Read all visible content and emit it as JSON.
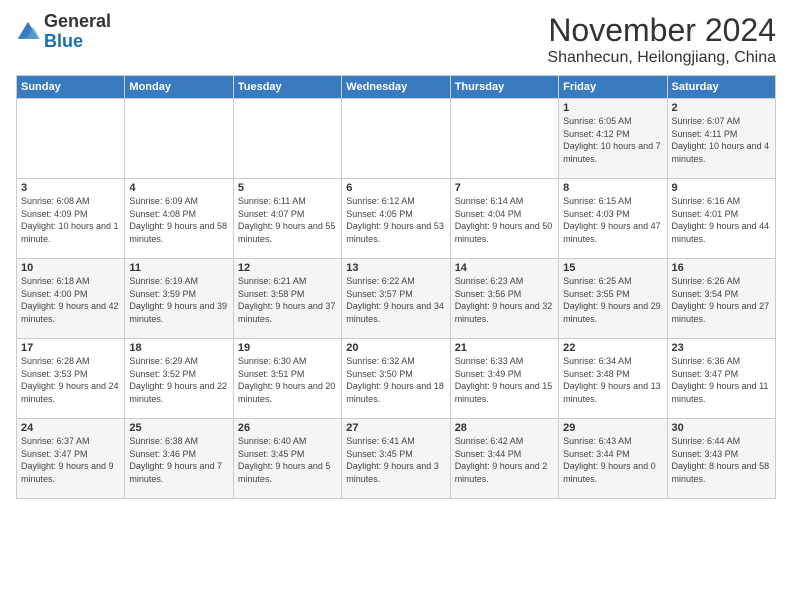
{
  "logo": {
    "general": "General",
    "blue": "Blue"
  },
  "title": {
    "month_year": "November 2024",
    "location": "Shanhecun, Heilongjiang, China"
  },
  "headers": [
    "Sunday",
    "Monday",
    "Tuesday",
    "Wednesday",
    "Thursday",
    "Friday",
    "Saturday"
  ],
  "weeks": [
    [
      {
        "day": "",
        "info": ""
      },
      {
        "day": "",
        "info": ""
      },
      {
        "day": "",
        "info": ""
      },
      {
        "day": "",
        "info": ""
      },
      {
        "day": "",
        "info": ""
      },
      {
        "day": "1",
        "info": "Sunrise: 6:05 AM\nSunset: 4:12 PM\nDaylight: 10 hours and 7 minutes."
      },
      {
        "day": "2",
        "info": "Sunrise: 6:07 AM\nSunset: 4:11 PM\nDaylight: 10 hours and 4 minutes."
      }
    ],
    [
      {
        "day": "3",
        "info": "Sunrise: 6:08 AM\nSunset: 4:09 PM\nDaylight: 10 hours and 1 minute."
      },
      {
        "day": "4",
        "info": "Sunrise: 6:09 AM\nSunset: 4:08 PM\nDaylight: 9 hours and 58 minutes."
      },
      {
        "day": "5",
        "info": "Sunrise: 6:11 AM\nSunset: 4:07 PM\nDaylight: 9 hours and 55 minutes."
      },
      {
        "day": "6",
        "info": "Sunrise: 6:12 AM\nSunset: 4:05 PM\nDaylight: 9 hours and 53 minutes."
      },
      {
        "day": "7",
        "info": "Sunrise: 6:14 AM\nSunset: 4:04 PM\nDaylight: 9 hours and 50 minutes."
      },
      {
        "day": "8",
        "info": "Sunrise: 6:15 AM\nSunset: 4:03 PM\nDaylight: 9 hours and 47 minutes."
      },
      {
        "day": "9",
        "info": "Sunrise: 6:16 AM\nSunset: 4:01 PM\nDaylight: 9 hours and 44 minutes."
      }
    ],
    [
      {
        "day": "10",
        "info": "Sunrise: 6:18 AM\nSunset: 4:00 PM\nDaylight: 9 hours and 42 minutes."
      },
      {
        "day": "11",
        "info": "Sunrise: 6:19 AM\nSunset: 3:59 PM\nDaylight: 9 hours and 39 minutes."
      },
      {
        "day": "12",
        "info": "Sunrise: 6:21 AM\nSunset: 3:58 PM\nDaylight: 9 hours and 37 minutes."
      },
      {
        "day": "13",
        "info": "Sunrise: 6:22 AM\nSunset: 3:57 PM\nDaylight: 9 hours and 34 minutes."
      },
      {
        "day": "14",
        "info": "Sunrise: 6:23 AM\nSunset: 3:56 PM\nDaylight: 9 hours and 32 minutes."
      },
      {
        "day": "15",
        "info": "Sunrise: 6:25 AM\nSunset: 3:55 PM\nDaylight: 9 hours and 29 minutes."
      },
      {
        "day": "16",
        "info": "Sunrise: 6:26 AM\nSunset: 3:54 PM\nDaylight: 9 hours and 27 minutes."
      }
    ],
    [
      {
        "day": "17",
        "info": "Sunrise: 6:28 AM\nSunset: 3:53 PM\nDaylight: 9 hours and 24 minutes."
      },
      {
        "day": "18",
        "info": "Sunrise: 6:29 AM\nSunset: 3:52 PM\nDaylight: 9 hours and 22 minutes."
      },
      {
        "day": "19",
        "info": "Sunrise: 6:30 AM\nSunset: 3:51 PM\nDaylight: 9 hours and 20 minutes."
      },
      {
        "day": "20",
        "info": "Sunrise: 6:32 AM\nSunset: 3:50 PM\nDaylight: 9 hours and 18 minutes."
      },
      {
        "day": "21",
        "info": "Sunrise: 6:33 AM\nSunset: 3:49 PM\nDaylight: 9 hours and 15 minutes."
      },
      {
        "day": "22",
        "info": "Sunrise: 6:34 AM\nSunset: 3:48 PM\nDaylight: 9 hours and 13 minutes."
      },
      {
        "day": "23",
        "info": "Sunrise: 6:36 AM\nSunset: 3:47 PM\nDaylight: 9 hours and 11 minutes."
      }
    ],
    [
      {
        "day": "24",
        "info": "Sunrise: 6:37 AM\nSunset: 3:47 PM\nDaylight: 9 hours and 9 minutes."
      },
      {
        "day": "25",
        "info": "Sunrise: 6:38 AM\nSunset: 3:46 PM\nDaylight: 9 hours and 7 minutes."
      },
      {
        "day": "26",
        "info": "Sunrise: 6:40 AM\nSunset: 3:45 PM\nDaylight: 9 hours and 5 minutes."
      },
      {
        "day": "27",
        "info": "Sunrise: 6:41 AM\nSunset: 3:45 PM\nDaylight: 9 hours and 3 minutes."
      },
      {
        "day": "28",
        "info": "Sunrise: 6:42 AM\nSunset: 3:44 PM\nDaylight: 9 hours and 2 minutes."
      },
      {
        "day": "29",
        "info": "Sunrise: 6:43 AM\nSunset: 3:44 PM\nDaylight: 9 hours and 0 minutes."
      },
      {
        "day": "30",
        "info": "Sunrise: 6:44 AM\nSunset: 3:43 PM\nDaylight: 8 hours and 58 minutes."
      }
    ]
  ],
  "colors": {
    "header_bg": "#3a7abf",
    "header_text": "#ffffff",
    "odd_row": "#f5f5f5",
    "even_row": "#ffffff"
  }
}
